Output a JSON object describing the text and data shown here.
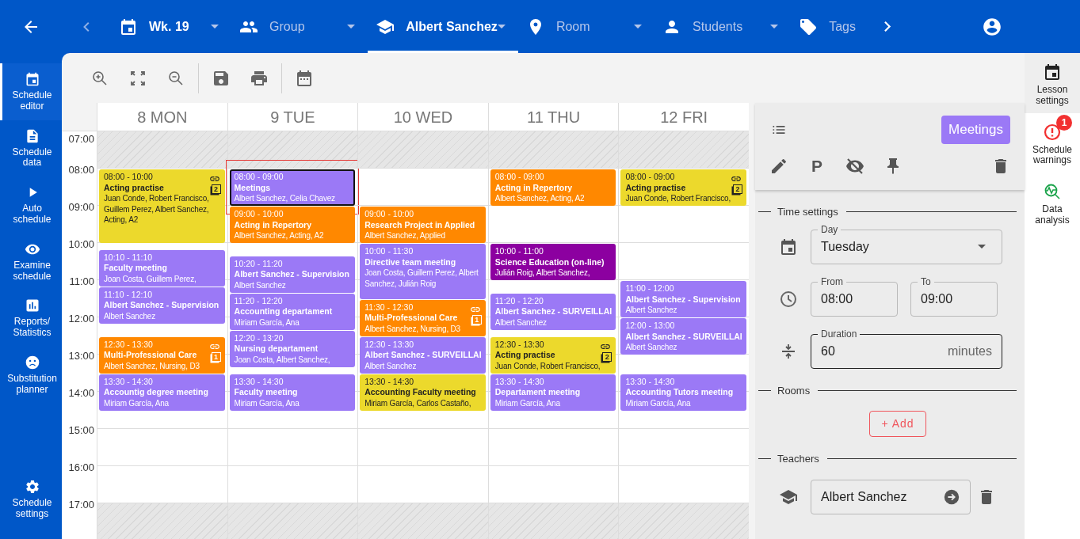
{
  "top_bar": {
    "filters": [
      {
        "kind": "week",
        "value": "Wk. 19",
        "selected": false
      },
      {
        "kind": "group",
        "placeholder": "Group",
        "selected": false
      },
      {
        "kind": "teacher",
        "value": "Albert Sanchez",
        "selected": true
      },
      {
        "kind": "room",
        "placeholder": "Room",
        "selected": false
      },
      {
        "kind": "student",
        "placeholder": "Students",
        "selected": false
      },
      {
        "kind": "tag",
        "placeholder": "Tags",
        "selected": false
      }
    ]
  },
  "sidebar": {
    "items": [
      {
        "kind": "editor",
        "label": "Schedule editor",
        "selected": true
      },
      {
        "kind": "data",
        "label": "Schedule data",
        "selected": false
      },
      {
        "kind": "auto",
        "label": "Auto schedule",
        "selected": false
      },
      {
        "kind": "examine",
        "label": "Examine schedule",
        "selected": false
      },
      {
        "kind": "reports",
        "label": "Reports/Statistics",
        "selected": false
      },
      {
        "kind": "substitution",
        "label": "Substitution planner",
        "selected": false
      },
      {
        "kind": "settings",
        "label": "Schedule settings",
        "selected": false
      }
    ]
  },
  "toolbar": {
    "groups": [
      [
        {
          "kind": "zoom_in"
        },
        {
          "kind": "fit"
        },
        {
          "kind": "zoom_out"
        }
      ],
      [
        {
          "kind": "save"
        },
        {
          "kind": "print"
        }
      ],
      [
        {
          "kind": "calendar"
        }
      ]
    ]
  },
  "calendar": {
    "hours": [
      {
        "label": "07:00",
        "closed": true
      },
      {
        "label": "08:00",
        "closed": false
      },
      {
        "label": "09:00",
        "closed": false
      },
      {
        "label": "10:00",
        "closed": false
      },
      {
        "label": "11:00",
        "closed": false
      },
      {
        "label": "12:00",
        "closed": false
      },
      {
        "label": "13:00",
        "closed": false
      },
      {
        "label": "14:00",
        "closed": false
      },
      {
        "label": "15:00",
        "closed": false
      },
      {
        "label": "16:00",
        "closed": false
      },
      {
        "label": "17:00",
        "closed": true
      }
    ],
    "days": [
      {
        "label": "8 MON",
        "events": [
          {
            "time": "08:00 - 10:00",
            "title": "Acting practise",
            "people": "Juan Conde, Robert Francisco, Guillem Perez, Albert Sanchez, Acting, A2",
            "color": "#ecd92c",
            "selected": false,
            "linked": true,
            "copies": "2"
          },
          {
            "time": "10:10 - 11:10",
            "title": "Faculty meeting",
            "people": "Joan Costa, Guillem Perez,",
            "color": "#9b79f6",
            "selected": false,
            "linked": false
          },
          {
            "time": "11:10 - 12:10",
            "title": "Albert Sanchez - Supervision",
            "people": "Albert Sanchez",
            "color": "#9b79f6",
            "selected": false,
            "linked": false
          },
          {
            "time": "12:30 - 13:30",
            "title": "Multi-Professional Care",
            "people": "Albert Sanchez, Nursing, D3",
            "color": "#ff8800",
            "selected": false,
            "linked": true,
            "copies": "1"
          },
          {
            "time": "13:30 - 14:30",
            "title": "Accountig degree meeting",
            "people": "Miriam García, Ana",
            "color": "#9b79f6",
            "selected": false,
            "linked": false
          }
        ]
      },
      {
        "label": "9 TUE",
        "events": [
          {
            "time": "08:00 - 09:00",
            "title": "Meetings",
            "people": "Albert Sanchez, Celia Chavez",
            "color": "#9b79f6",
            "selected": true,
            "linked": false
          },
          {
            "time": "09:00 - 10:00",
            "title": "Acting in Repertory",
            "people": "Albert Sanchez, Acting, A2",
            "color": "#ff8800",
            "selected": false,
            "linked": false
          },
          {
            "time": "10:20 - 11:20",
            "title": "Albert Sanchez - Supervision",
            "people": "Albert Sanchez",
            "color": "#9b79f6",
            "selected": false,
            "linked": false
          },
          {
            "time": "11:20 - 12:20",
            "title": "Accounting departament",
            "people": "Miriam García, Ana",
            "color": "#9b79f6",
            "selected": false,
            "linked": false
          },
          {
            "time": "12:20 - 13:20",
            "title": "Nursing departament",
            "people": "Joan Costa, Albert Sanchez,",
            "color": "#9b79f6",
            "selected": false,
            "linked": false
          },
          {
            "time": "13:30 - 14:30",
            "title": "Faculty meeting",
            "people": "Miriam García, Ana",
            "color": "#9b79f6",
            "selected": false,
            "linked": false
          }
        ]
      },
      {
        "label": "10 WED",
        "events": [
          {
            "time": "09:00 - 10:00",
            "title": "Research Project in Applied",
            "people": "Albert Sanchez, Applied",
            "color": "#ff8800",
            "selected": false,
            "linked": false
          },
          {
            "time": "10:00 - 11:30",
            "title": "Directive team meeting",
            "people": "Joan Costa, Guillem Perez, Albert Sanchez, Julián Roig",
            "color": "#9b79f6",
            "selected": false,
            "linked": false
          },
          {
            "time": "11:30 - 12:30",
            "title": "Multi-Professional Care",
            "people": "Albert Sanchez, Nursing, D3",
            "color": "#ff8800",
            "selected": false,
            "linked": true,
            "copies": "1"
          },
          {
            "time": "12:30 - 13:30",
            "title": "Albert Sanchez - SURVEILLAI",
            "people": "Albert Sanchez",
            "color": "#9b79f6",
            "selected": false,
            "linked": false
          },
          {
            "time": "13:30 - 14:30",
            "title": "Accounting Faculty meeting",
            "people": "Miriam García, Carlos Castaño,",
            "color": "#ecd92c",
            "selected": false,
            "linked": false
          }
        ]
      },
      {
        "label": "11 THU",
        "events": [
          {
            "time": "08:00 - 09:00",
            "title": "Acting in Repertory",
            "people": "Albert Sanchez, Acting, A2",
            "color": "#ff8800",
            "selected": false,
            "linked": false
          },
          {
            "time": "10:00 - 11:00",
            "title": "Science Education (on-line)",
            "people": "Julián Roig, Albert Sanchez,",
            "color": "#8c00a0",
            "selected": false,
            "linked": false
          },
          {
            "time": "11:20 - 12:20",
            "title": "Albert Sanchez - SURVEILLAI",
            "people": "Albert Sanchez",
            "color": "#9b79f6",
            "selected": false,
            "linked": false
          },
          {
            "time": "12:30 - 13:30",
            "title": "Acting practise",
            "people": "Juan Conde, Robert Francisco,",
            "color": "#ecd92c",
            "selected": false,
            "linked": true,
            "copies": "2"
          },
          {
            "time": "13:30 - 14:30",
            "title": "Departament meeting",
            "people": "Miriam García, Ana",
            "color": "#9b79f6",
            "selected": false,
            "linked": false
          }
        ]
      },
      {
        "label": "12 FRI",
        "events": [
          {
            "time": "08:00 - 09:00",
            "title": "Acting practise",
            "people": "Juan Conde, Robert Francisco,",
            "color": "#ecd92c",
            "selected": false,
            "linked": true,
            "copies": "2"
          },
          {
            "time": "11:00 - 12:00",
            "title": "Albert Sanchez - Supervision",
            "people": "Albert Sanchez",
            "color": "#9b79f6",
            "selected": false,
            "linked": false
          },
          {
            "time": "12:00 - 13:00",
            "title": "Albert Sanchez - SURVEILLAI",
            "people": "Albert Sanchez",
            "color": "#9b79f6",
            "selected": false,
            "linked": false
          },
          {
            "time": "13:30 - 14:30",
            "title": "Accounting Tutors meeting",
            "people": "Miriam García, Ana",
            "color": "#9b79f6",
            "selected": false,
            "linked": false
          }
        ]
      }
    ]
  },
  "lesson_panel": {
    "category": "Meetings",
    "actions": [
      {
        "kind": "edit"
      },
      {
        "kind": "letter",
        "glyph": "P"
      },
      {
        "kind": "hide"
      },
      {
        "kind": "pin"
      },
      {
        "kind": "delete"
      }
    ],
    "time_settings": {
      "title": "Time settings",
      "day": {
        "label": "Day",
        "value": "Tuesday"
      },
      "from": {
        "label": "From",
        "value": "08:00"
      },
      "to": {
        "label": "To",
        "value": "09:00"
      },
      "duration": {
        "label": "Duration",
        "value": "60",
        "unit": "minutes",
        "focused": true
      }
    },
    "rooms": {
      "title": "Rooms",
      "add_button": "+ Add"
    },
    "teachers": {
      "title": "Teachers",
      "items": [
        {
          "name": "Albert Sanchez"
        }
      ]
    }
  },
  "right_bar": {
    "items": [
      {
        "kind": "lesson",
        "label": "Lesson settings",
        "selected": true
      },
      {
        "kind": "warnings",
        "label": "Schedule warnings",
        "selected": false,
        "badge": "1"
      },
      {
        "kind": "analysis",
        "label": "Data analysis",
        "selected": false
      }
    ]
  }
}
